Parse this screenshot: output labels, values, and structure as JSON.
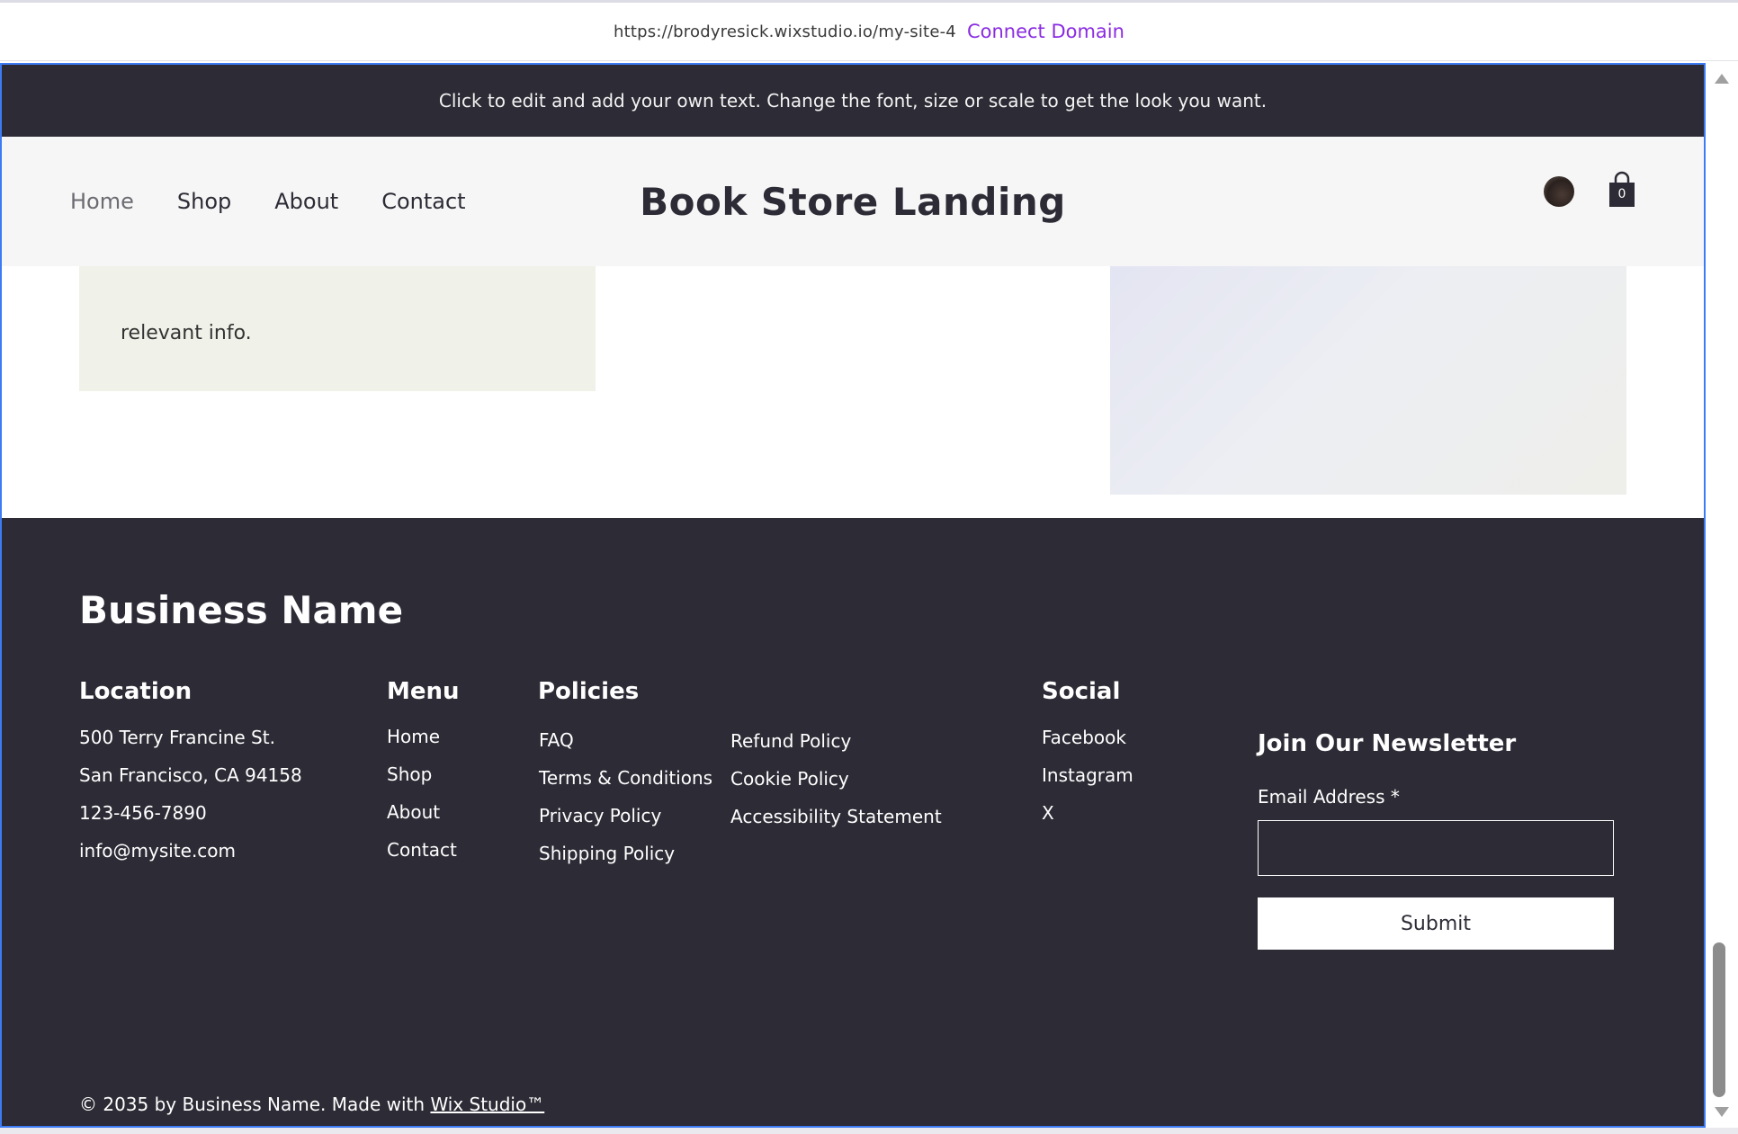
{
  "url_bar": {
    "url": "https://brodyresick.wixstudio.io/my-site-4",
    "connect_label": "Connect Domain"
  },
  "announcement": {
    "text": "Click to edit and add your own text. Change the font, size or scale to get the look you want."
  },
  "header": {
    "nav": [
      "Home",
      "Shop",
      "About",
      "Contact"
    ],
    "active_nav": "Home",
    "brand": "Book Store Landing",
    "cart_count": "0"
  },
  "content": {
    "card_snippet": "relevant info."
  },
  "footer": {
    "business_name": "Business Name",
    "location": {
      "heading": "Location",
      "lines": [
        "500 Terry Francine St.",
        "San Francisco, CA 94158",
        "123-456-7890",
        "info@mysite.com"
      ]
    },
    "menu": {
      "heading": "Menu",
      "items": [
        "Home",
        "Shop",
        "About",
        "Contact"
      ]
    },
    "policies": {
      "heading": "Policies",
      "col1": [
        "FAQ",
        "Terms & Conditions",
        "Privacy Policy",
        "Shipping Policy"
      ],
      "col2": [
        "Refund Policy",
        "Cookie Policy",
        "Accessibility Statement"
      ]
    },
    "social": {
      "heading": "Social",
      "items": [
        "Facebook",
        "Instagram",
        "X"
      ]
    },
    "newsletter": {
      "heading": "Join Our Newsletter",
      "email_label": "Email Address *",
      "email_value": "",
      "submit_label": "Submit"
    },
    "copyright_prefix": "© 2035 by Business Name. Made with ",
    "copyright_link": "Wix Studio™"
  },
  "colors": {
    "dark": "#2d2b35",
    "accent_link": "#8a2be2",
    "frame_border": "#3d7bf5",
    "header_bg": "#f6f6f6"
  }
}
